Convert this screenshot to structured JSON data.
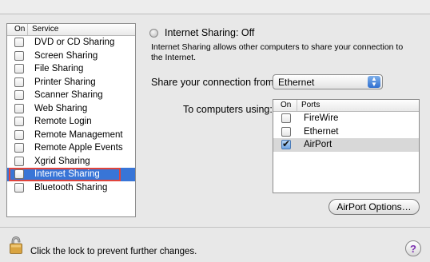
{
  "service_list": {
    "header_on": "On",
    "header_service": "Service",
    "items": [
      {
        "label": "DVD or CD Sharing",
        "checked": false
      },
      {
        "label": "Screen Sharing",
        "checked": false
      },
      {
        "label": "File Sharing",
        "checked": false
      },
      {
        "label": "Printer Sharing",
        "checked": false
      },
      {
        "label": "Scanner Sharing",
        "checked": false
      },
      {
        "label": "Web Sharing",
        "checked": false
      },
      {
        "label": "Remote Login",
        "checked": false
      },
      {
        "label": "Remote Management",
        "checked": false
      },
      {
        "label": "Remote Apple Events",
        "checked": false
      },
      {
        "label": "Xgrid Sharing",
        "checked": false
      },
      {
        "label": "Internet Sharing",
        "checked": false,
        "selected": true
      },
      {
        "label": "Bluetooth Sharing",
        "checked": false
      }
    ]
  },
  "status": {
    "text": "Internet Sharing: Off"
  },
  "description": "Internet Sharing allows other computers to share your connection to the Internet.",
  "share_from": {
    "label": "Share your connection from:",
    "value": "Ethernet"
  },
  "to_computers": {
    "label": "To computers using:",
    "header_on": "On",
    "header_ports": "Ports",
    "ports": [
      {
        "label": "FireWire",
        "checked": false
      },
      {
        "label": "Ethernet",
        "checked": false
      },
      {
        "label": "AirPort",
        "checked": true,
        "selected": true
      }
    ]
  },
  "airport_options_label": "AirPort Options…",
  "lock_text": "Click the lock to prevent further changes.",
  "help_label": "?",
  "colors": {
    "selection": "#3875d7",
    "highlight_box": "#e0443c"
  }
}
